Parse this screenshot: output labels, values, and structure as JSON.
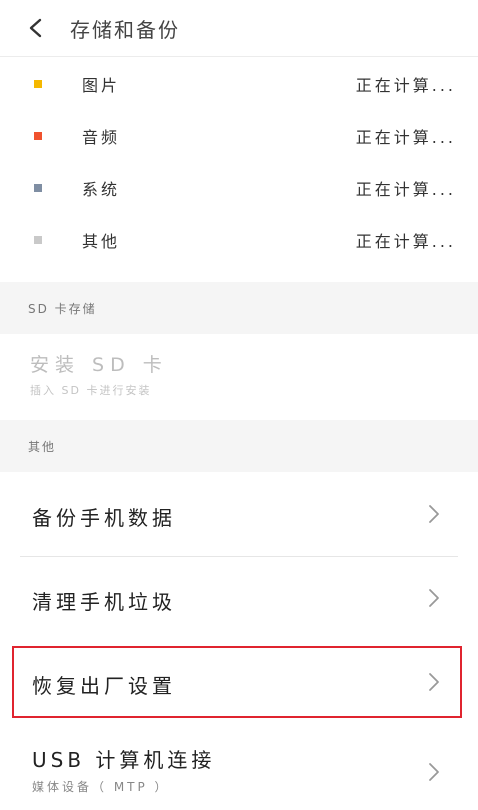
{
  "header": {
    "title": "存储和备份"
  },
  "storage": [
    {
      "label": "图片",
      "value": "正在计算...",
      "color": "#f5b800"
    },
    {
      "label": "音频",
      "value": "正在计算...",
      "color": "#f0522e"
    },
    {
      "label": "系统",
      "value": "正在计算...",
      "color": "#7f8ea3"
    },
    {
      "label": "其他",
      "value": "正在计算...",
      "color": "#c9c9c9"
    }
  ],
  "sd_section": {
    "label": "SD 卡存储"
  },
  "sd": {
    "title": "安装 SD 卡",
    "subtitle": "插入 SD 卡进行安装"
  },
  "other_section": {
    "label": "其他"
  },
  "menu": [
    {
      "label": "备份手机数据"
    },
    {
      "label": "清理手机垃圾"
    },
    {
      "label": "恢复出厂设置"
    },
    {
      "label": "USB 计算机连接",
      "subtitle": "媒体设备（ MTP ）"
    }
  ],
  "icons": {
    "back": "chevron-left-icon",
    "chevron": "chevron-right-icon"
  },
  "colors": {
    "highlight": "#e0242f",
    "section_bg": "#f5f5f5"
  }
}
